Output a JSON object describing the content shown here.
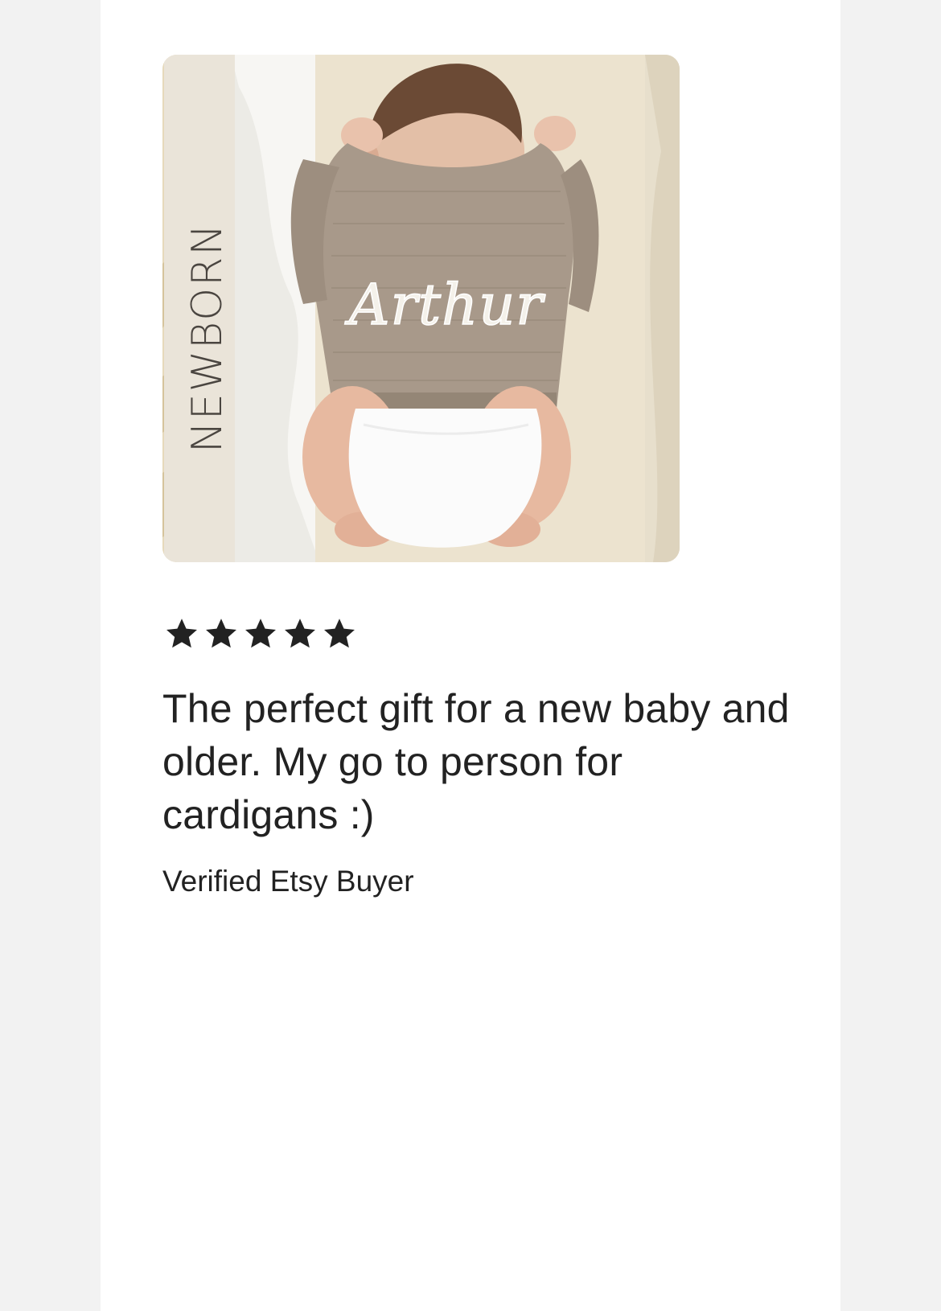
{
  "review": {
    "photo": {
      "alt": "Newborn baby sleeping in a knitted cardigan with a hand-embroidered name",
      "side_banner_text": "NEWBORN",
      "embroidered_name": "Arthur"
    },
    "rating": {
      "value": 5,
      "max": 5,
      "star_icon": "star-icon",
      "star_color": "#222222"
    },
    "text": "The perfect gift for a new baby and older. My go to person for cardigans :)",
    "reviewer": "Verified Etsy Buyer"
  },
  "colors": {
    "page_background": "#f2f2f2",
    "card_background": "#ffffff",
    "text": "#222222"
  }
}
